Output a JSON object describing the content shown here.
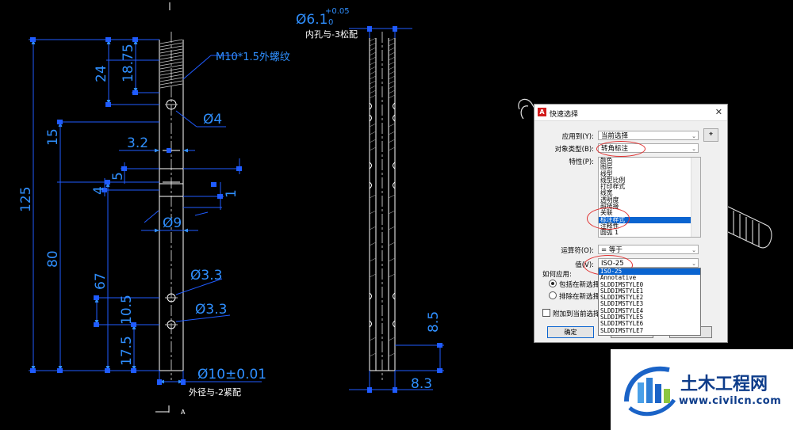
{
  "drawing": {
    "dims": {
      "d125": "125",
      "d80": "80",
      "d67": "67",
      "d24": "24",
      "d18_75": "18.75",
      "d15": "15",
      "d3_2": "3.2",
      "d5": "5",
      "d4": "4",
      "d1": "1",
      "d_phi9": "Ø9",
      "d_phi4": "Ø4",
      "d_phi3_3a": "Ø3.3",
      "d_phi3_3b": "Ø3.3",
      "d10_5": "10.5",
      "d17_5": "17.5",
      "d_phi10": "Ø10±0.01",
      "d_phi6_1": "Ø6.1",
      "tol_upper": "+0.05",
      "tol_lower": "0",
      "d8_5": "8.5",
      "d8_3": "8.3"
    },
    "notes": {
      "thread": "M10*1.5外螺纹",
      "inner_hole_fit": "内孔与-3松配",
      "outer_fit": "外径与-2紧配",
      "view_label": "A"
    }
  },
  "dialog": {
    "title": "快速选择",
    "apply_to_label": "应用到(Y):",
    "apply_to_value": "当前选择",
    "object_type_label": "对象类型(B):",
    "object_type_value": "转角标注",
    "properties_label": "特性(P):",
    "properties": [
      "颜色",
      "图层",
      "线型",
      "线型比例",
      "打印样式",
      "线宽",
      "透明度",
      "超链接",
      "关联",
      "标注样式",
      "注释性",
      "圆弧 1"
    ],
    "selected_property": "标注样式",
    "operator_label": "运算符(O):",
    "operator_value": "= 等于",
    "value_label": "值(V):",
    "value_value": "ISO-25",
    "value_options": [
      "ISO-25",
      "Annotative",
      "SLDDIMSTYLE0",
      "SLDDIMSTYLE1",
      "SLDDIMSTYLE2",
      "SLDDIMSTYLE3",
      "SLDDIMSTYLE4",
      "SLDDIMSTYLE5",
      "SLDDIMSTYLE6",
      "SLDDIMSTYLE7"
    ],
    "how_to_apply_label": "如何应用:",
    "include_label": "包括在新选择",
    "exclude_label": "排除在新选择",
    "append_label": "附加到当前选择",
    "ok_label": "确定",
    "cancel_label": "取消",
    "help_label": "帮助"
  },
  "watermark": {
    "name": "土木工程网",
    "url": "www.civilcn.com"
  },
  "colors": {
    "dimension": "#2f8fff",
    "dim_line": "#1f5bff",
    "geometry": "#ffffff",
    "centerline": "#c0c0c0",
    "selection": "#0a64d0",
    "callout": "#e03030",
    "brand": "#0d3c8a"
  }
}
